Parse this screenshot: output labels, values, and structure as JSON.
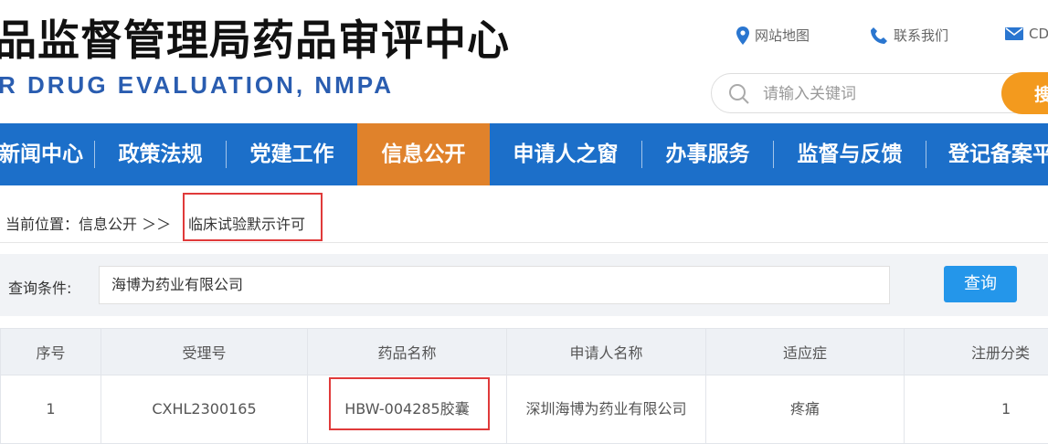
{
  "header": {
    "title": "品监督管理局药品审评中心",
    "subtitle": "R DRUG EVALUATION, NMPA",
    "links": [
      {
        "label": "网站地图",
        "icon": "location-pin-icon"
      },
      {
        "label": "联系我们",
        "icon": "phone-icon"
      },
      {
        "label": "CD",
        "icon": "mail-icon"
      }
    ],
    "search": {
      "placeholder": "请输入关键词",
      "button_label": "搜"
    }
  },
  "nav": {
    "items": [
      {
        "label": "新闻中心",
        "active": false
      },
      {
        "label": "政策法规",
        "active": false
      },
      {
        "label": "党建工作",
        "active": false
      },
      {
        "label": "信息公开",
        "active": true
      },
      {
        "label": "申请人之窗",
        "active": false
      },
      {
        "label": "办事服务",
        "active": false
      },
      {
        "label": "监督与反馈",
        "active": false
      },
      {
        "label": "登记备案平",
        "active": false
      }
    ]
  },
  "breadcrumb": {
    "prefix": "当前位置：信息公开 ＞＞",
    "current": "临床试验默示许可"
  },
  "query": {
    "label": "查询条件:",
    "value": "海博为药业有限公司",
    "button_label": "查询"
  },
  "table": {
    "headers": [
      "序号",
      "受理号",
      "药品名称",
      "申请人名称",
      "适应症",
      "注册分类"
    ],
    "rows": [
      [
        "1",
        "CXHL2300165",
        "HBW-004285胶囊",
        "深圳海博为药业有限公司",
        "疼痛",
        "1"
      ]
    ]
  },
  "colors": {
    "nav_bg": "#1c6fc9",
    "nav_active": "#e0822b",
    "search_button": "#f39a1e",
    "query_button": "#2496ea",
    "highlight": "#e03a3a"
  }
}
